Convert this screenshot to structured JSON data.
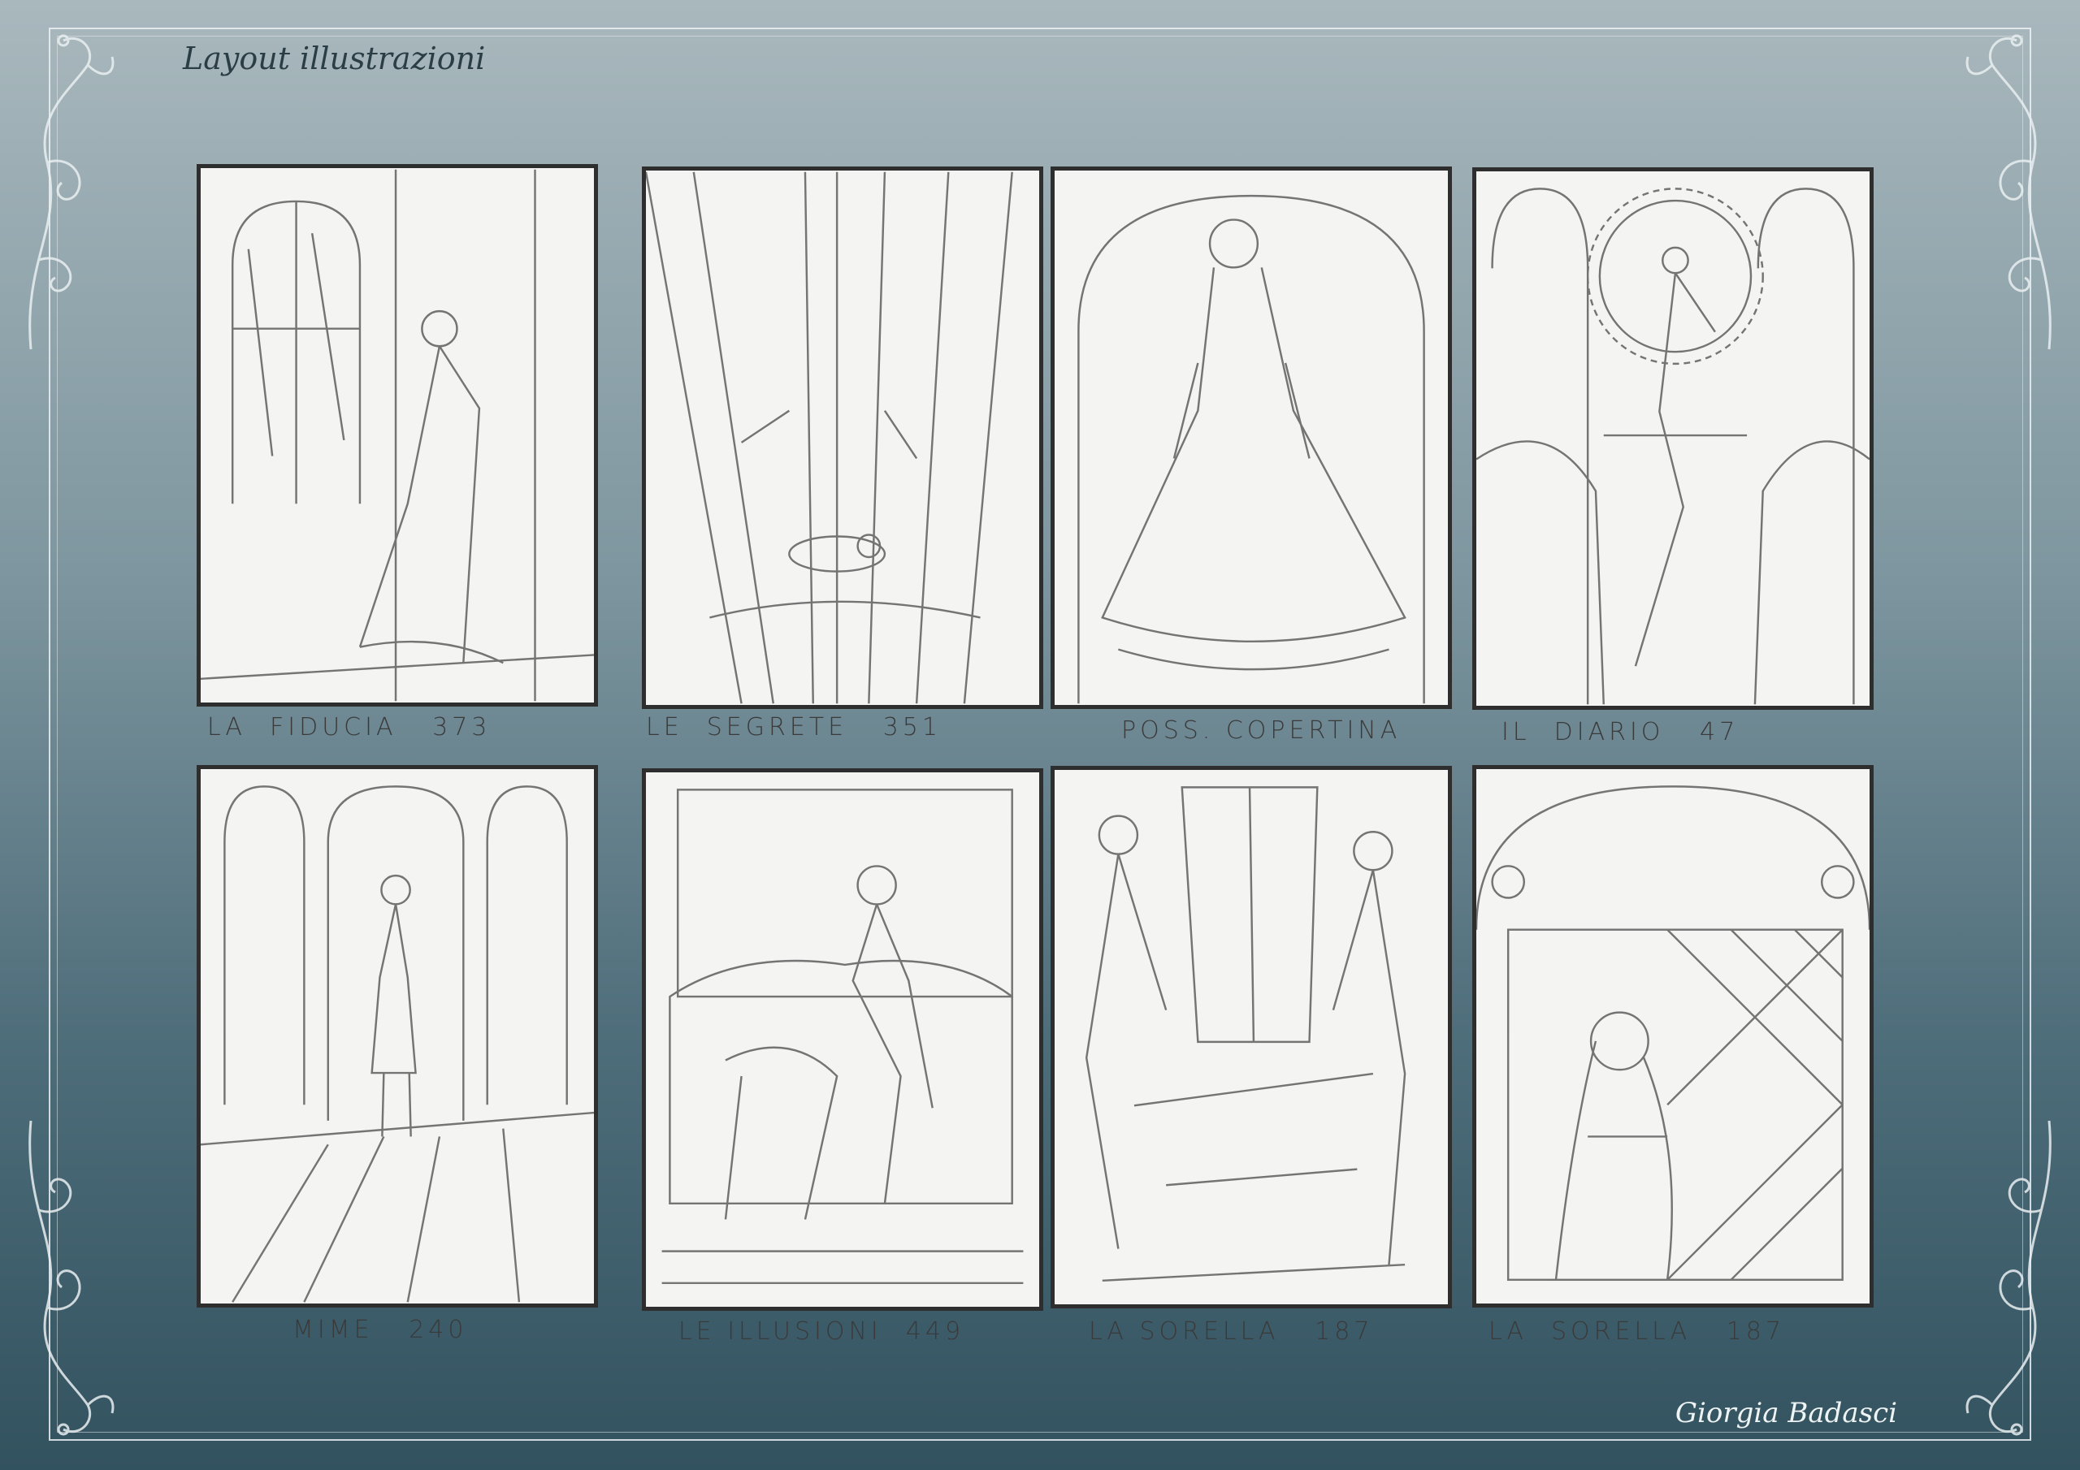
{
  "header": {
    "title": "Layout illustrazioni"
  },
  "footer": {
    "signature": "Giorgia Badasci"
  },
  "colors": {
    "background_top": "#a9b8bd",
    "background_bottom": "#33525f",
    "paper": "#f4f4f2",
    "pencil": "#2e2e2e"
  },
  "panels": [
    {
      "caption": "LA  FIDUCIA   373",
      "icon": "sketch-woman-at-door"
    },
    {
      "caption": "LE  SEGRETE   351",
      "icon": "sketch-curtain-figure"
    },
    {
      "caption": "POSS. COPERTINA",
      "icon": "sketch-woman-portrait"
    },
    {
      "caption": "IL  DIARIO   47",
      "icon": "sketch-figure-at-mirror"
    },
    {
      "caption": "MIME   240",
      "icon": "sketch-woman-at-windows"
    },
    {
      "caption": "LE ILLUSIONI  449",
      "icon": "sketch-girl-on-bed"
    },
    {
      "caption": "LA SORELLA   187",
      "icon": "sketch-figures-at-doorway"
    },
    {
      "caption": "LA  SORELLA   187",
      "icon": "sketch-girl-in-mirror"
    }
  ]
}
